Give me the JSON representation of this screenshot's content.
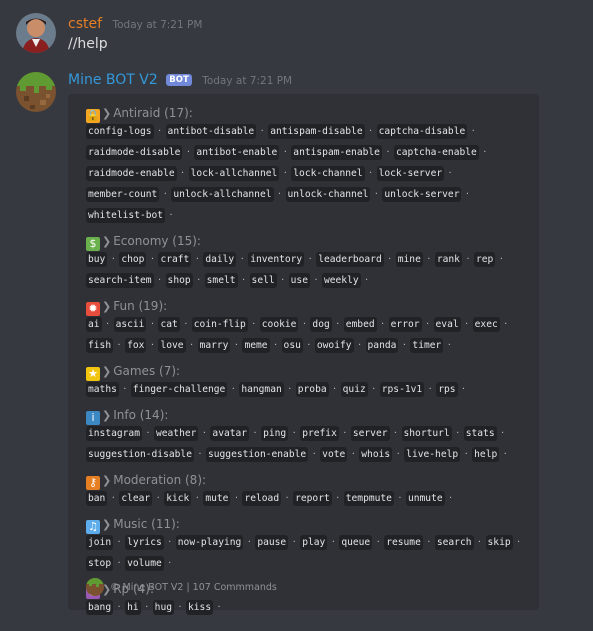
{
  "messages": [
    {
      "username": "cstef",
      "username_color": "#e67e22",
      "timestamp": "Today at 7:21 PM",
      "content": "//help"
    },
    {
      "username": "Mine BOT V2",
      "username_color": "#3498db",
      "badge": "BOT",
      "timestamp": "Today at 7:21 PM",
      "embed": {
        "categories": [
          {
            "icon": "lock-icon",
            "title": "Antiraid (17):",
            "commands": [
              "config-logs",
              "antibot-disable",
              "antispam-disable",
              "captcha-disable",
              "raidmode-disable",
              "antibot-enable",
              "antispam-enable",
              "captcha-enable",
              "raidmode-enable",
              "lock-allchannel",
              "lock-channel",
              "lock-server",
              "member-count",
              "unlock-allchannel",
              "unlock-channel",
              "unlock-server",
              "whitelist-bot"
            ]
          },
          {
            "icon": "dollar-icon",
            "title": "Economy (15):",
            "commands": [
              "buy",
              "chop",
              "craft",
              "daily",
              "inventory",
              "leaderboard",
              "mine",
              "rank",
              "rep",
              "search-item",
              "shop",
              "smelt",
              "sell",
              "use",
              "weekly"
            ]
          },
          {
            "icon": "explosion-icon",
            "title": "Fun (19):",
            "commands": [
              "ai",
              "ascii",
              "cat",
              "coin-flip",
              "cookie",
              "dog",
              "embed",
              "error",
              "eval",
              "exec",
              "fish",
              "fox",
              "love",
              "marry",
              "meme",
              "osu",
              "owoify",
              "panda",
              "timer"
            ]
          },
          {
            "icon": "trophy-icon",
            "title": "Games (7):",
            "commands": [
              "maths",
              "finger-challenge",
              "hangman",
              "proba",
              "quiz",
              "rps-1v1",
              "rps"
            ]
          },
          {
            "icon": "info-icon",
            "title": "Info (14):",
            "commands": [
              "instagram",
              "weather",
              "avatar",
              "ping",
              "prefix",
              "server",
              "shorturl",
              "stats",
              "suggestion-disable",
              "suggestion-enable",
              "vote",
              "whois",
              "live-help",
              "help"
            ]
          },
          {
            "icon": "key-icon",
            "title": "Moderation (8):",
            "commands": [
              "ban",
              "clear",
              "kick",
              "mute",
              "reload",
              "report",
              "tempmute",
              "unmute"
            ]
          },
          {
            "icon": "music-notes-icon",
            "title": "Music (11):",
            "commands": [
              "join",
              "lyrics",
              "now-playing",
              "pause",
              "play",
              "queue",
              "resume",
              "search",
              "skip",
              "stop",
              "volume"
            ]
          },
          {
            "icon": "masks-icon",
            "title": "Rp (4):",
            "commands": [
              "bang",
              "hi",
              "hug",
              "kiss"
            ]
          }
        ],
        "footer": "© Mine BOT V2 | 107 Commmands"
      }
    }
  ],
  "icon_colors": {
    "lock-icon": "#f5a623",
    "dollar-icon": "#6ab04c",
    "explosion-icon": "#e74c3c",
    "trophy-icon": "#f1c40f",
    "info-icon": "#3b88c3",
    "key-icon": "#e67e22",
    "music-notes-icon": "#5dadec",
    "masks-icon": "#9b59b6"
  }
}
